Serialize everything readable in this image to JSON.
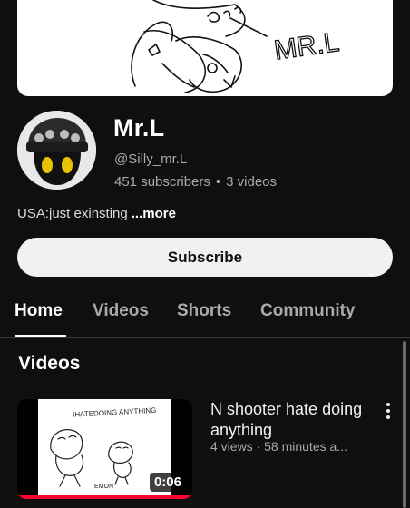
{
  "channel": {
    "name": "Mr.L",
    "handle": "@Silly_mr.L",
    "subscribers": "451 subscribers",
    "separator": "•",
    "videos_count": "3 videos",
    "description": "USA:just exinsting",
    "more_label": "...more",
    "banner_text": "MR.L"
  },
  "subscribe_label": "Subscribe",
  "tabs": [
    {
      "label": "Home",
      "active": true
    },
    {
      "label": "Videos",
      "active": false
    },
    {
      "label": "Shorts",
      "active": false
    },
    {
      "label": "Community",
      "active": false
    }
  ],
  "section_title": "Videos",
  "videos": [
    {
      "title": "N shooter hate doing anything",
      "meta": "4 views · 58 minutes a...",
      "duration": "0:06",
      "thumbnail_caption": "IHATEDOING ANYTHING",
      "thumbnail_label": "EMON",
      "watched_fraction": 1.0
    }
  ],
  "colors": {
    "background": "#0f0f0f",
    "accent_progress": "#ff0033",
    "subscribe_bg": "#f1f1f1",
    "muted_text": "#aaaaaa"
  }
}
